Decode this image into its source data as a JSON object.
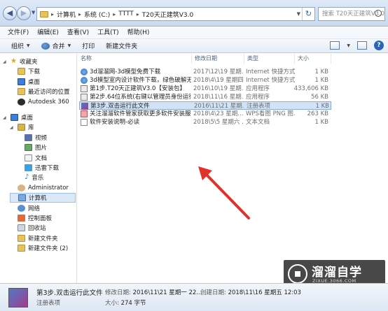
{
  "address": {
    "breadcrumbs": [
      "计算机",
      "系统 (C:)",
      "TTTT",
      "T20天正建筑V3.0"
    ],
    "search_placeholder": "搜索 T20天正建筑V3.0"
  },
  "menu": [
    "文件(F)",
    "编辑(E)",
    "查看(V)",
    "工具(T)",
    "帮助(H)"
  ],
  "toolbar": {
    "organize": "组织",
    "share": "合并",
    "print": "打印",
    "new_folder": "新建文件夹"
  },
  "sidebar": [
    {
      "label": "收藏夹",
      "icon": "star-icon",
      "indent": 0
    },
    {
      "label": "下载",
      "icon": "folder-icon",
      "indent": 1
    },
    {
      "label": "桌面",
      "icon": "desktop-icon",
      "indent": 1
    },
    {
      "label": "最近访问的位置",
      "icon": "recent-icon",
      "indent": 1
    },
    {
      "label": "Autodesk 360",
      "icon": "autodesk-icon",
      "indent": 1
    },
    {
      "label": "桌面",
      "icon": "desktop-icon",
      "indent": 0
    },
    {
      "label": "库",
      "icon": "library-icon",
      "indent": 1
    },
    {
      "label": "视频",
      "icon": "video-icon",
      "indent": 2
    },
    {
      "label": "图片",
      "icon": "picture-icon",
      "indent": 2
    },
    {
      "label": "文档",
      "icon": "document-icon",
      "indent": 2
    },
    {
      "label": "迅雷下载",
      "icon": "thunder-icon",
      "indent": 2
    },
    {
      "label": "音乐",
      "icon": "music-icon",
      "indent": 2
    },
    {
      "label": "Administrator",
      "icon": "user-icon",
      "indent": 1
    },
    {
      "label": "计算机",
      "icon": "computer-icon",
      "indent": 1,
      "selected": true
    },
    {
      "label": "网络",
      "icon": "network-icon",
      "indent": 1
    },
    {
      "label": "控制面板",
      "icon": "control-panel-icon",
      "indent": 1
    },
    {
      "label": "回收站",
      "icon": "recycle-bin-icon",
      "indent": 1
    },
    {
      "label": "新建文件夹",
      "icon": "folder-icon",
      "indent": 1
    },
    {
      "label": "新建文件夹 (2)",
      "icon": "folder-icon",
      "indent": 1
    }
  ],
  "columns": {
    "name": "名称",
    "date": "修改日期",
    "type": "类型",
    "size": "大小"
  },
  "files": [
    {
      "name": "3d溜溜网-3d模型免费下载",
      "date": "2017\\12\\19 星期...",
      "type": "Internet 快捷方式",
      "size": "1 KB",
      "icon": "link"
    },
    {
      "name": "3d模型室内设计软件下载，绿色破解无...",
      "date": "2018\\4\\19 星期四...",
      "type": "Internet 快捷方式",
      "size": "1 KB",
      "icon": "link"
    },
    {
      "name": "第1步.T20天正建筑V3.0【安装包】",
      "date": "2016\\10\\19 星期...",
      "type": "应用程序",
      "size": "433,606 KB",
      "icon": "exe"
    },
    {
      "name": "第2步.64位系统(右键以管理员身份运行)",
      "date": "2018\\11\\16 星期...",
      "type": "应用程序",
      "size": "56 KB",
      "icon": "exe"
    },
    {
      "name": "第3步.双击运行此文件",
      "date": "2016\\11\\21 星期...",
      "type": "注册表项",
      "size": "1 KB",
      "icon": "reg",
      "selected": true
    },
    {
      "name": "关注溜溜软件管家获取更多软件安装服务",
      "date": "2018\\4\\23 星期...",
      "type": "WPS看图 PNG 图...",
      "size": "263 KB",
      "icon": "png"
    },
    {
      "name": "软件安装说明-必读",
      "date": "2018\\5\\5 星期六 ...",
      "type": "文本文档",
      "size": "1 KB",
      "icon": "txt"
    }
  ],
  "details": {
    "name": "第3步.双击运行此文件",
    "type": "注册表项",
    "modified_label": "修改日期:",
    "modified": "2016\\11\\21 星期一 22...",
    "created_label": "创建日期:",
    "created": "2018\\11\\16 星期五 12:03",
    "size_label": "大小:",
    "size": "274 字节"
  },
  "watermark": {
    "brand": "溜溜自学",
    "url": "ZIXUE.3066.COM"
  }
}
